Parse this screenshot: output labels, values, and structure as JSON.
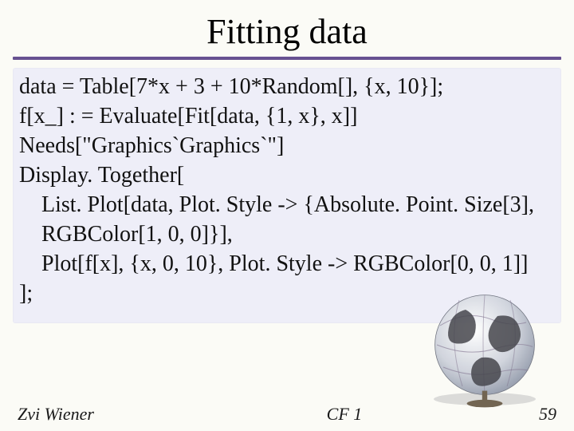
{
  "title": "Fitting data",
  "code": {
    "l1": "data = Table[7*x + 3 + 10*Random[], {x, 10}];",
    "l2": "f[x_] : = Evaluate[Fit[data, {1, x}, x]]",
    "l3": "Needs[\"Graphics`Graphics`\"]",
    "l4": "Display. Together[",
    "l5": "List. Plot[data, Plot. Style -> {Absolute. Point. Size[3],",
    "l6": "RGBColor[1, 0, 0]}],",
    "l7": "Plot[f[x], {x, 0, 10}, Plot. Style -> RGBColor[0, 0, 1]]",
    "l8": "];"
  },
  "footer": {
    "author": "Zvi Wiener",
    "center": "CF 1",
    "page": "59"
  }
}
